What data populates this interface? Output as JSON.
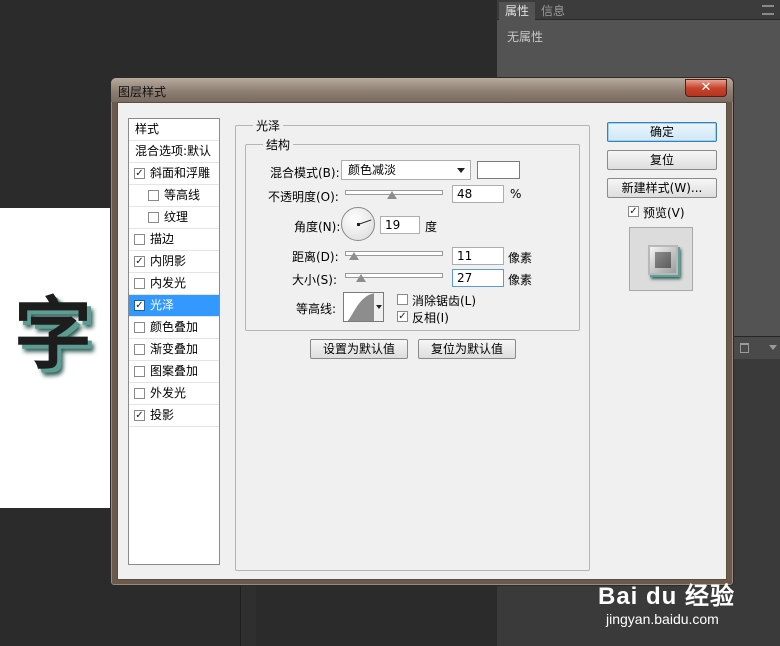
{
  "canvas": {
    "glyph": "字"
  },
  "properties_panel": {
    "tabs": [
      {
        "label": "属性",
        "active": true
      },
      {
        "label": "信息",
        "active": false
      }
    ],
    "body_text": "无属性"
  },
  "dialog": {
    "title": "图层样式",
    "close_label": "✕",
    "styles_list": {
      "header": "样式",
      "items": [
        {
          "label": "混合选项:默认",
          "checkbox": false,
          "checked": false,
          "indent": false,
          "selected": false
        },
        {
          "label": "斜面和浮雕",
          "checkbox": true,
          "checked": true,
          "indent": false,
          "selected": false
        },
        {
          "label": "等高线",
          "checkbox": true,
          "checked": false,
          "indent": true,
          "selected": false
        },
        {
          "label": "纹理",
          "checkbox": true,
          "checked": false,
          "indent": true,
          "selected": false
        },
        {
          "label": "描边",
          "checkbox": true,
          "checked": false,
          "indent": false,
          "selected": false
        },
        {
          "label": "内阴影",
          "checkbox": true,
          "checked": true,
          "indent": false,
          "selected": false
        },
        {
          "label": "内发光",
          "checkbox": true,
          "checked": false,
          "indent": false,
          "selected": false
        },
        {
          "label": "光泽",
          "checkbox": true,
          "checked": true,
          "indent": false,
          "selected": true
        },
        {
          "label": "颜色叠加",
          "checkbox": true,
          "checked": false,
          "indent": false,
          "selected": false
        },
        {
          "label": "渐变叠加",
          "checkbox": true,
          "checked": false,
          "indent": false,
          "selected": false
        },
        {
          "label": "图案叠加",
          "checkbox": true,
          "checked": false,
          "indent": false,
          "selected": false
        },
        {
          "label": "外发光",
          "checkbox": true,
          "checked": false,
          "indent": false,
          "selected": false
        },
        {
          "label": "投影",
          "checkbox": true,
          "checked": true,
          "indent": false,
          "selected": false
        }
      ]
    },
    "satin": {
      "group_title": "光泽",
      "structure_title": "结构",
      "blend_mode_label": "混合模式(B):",
      "blend_mode_value": "颜色减淡",
      "blend_color": "#ffffff",
      "opacity_label": "不透明度(O):",
      "opacity_value": "48",
      "opacity_unit": "%",
      "angle_label": "角度(N):",
      "angle_value": "19",
      "angle_unit": "度",
      "distance_label": "距离(D):",
      "distance_value": "11",
      "distance_unit": "像素",
      "size_label": "大小(S):",
      "size_value": "27",
      "size_unit": "像素",
      "contour_label": "等高线:",
      "anti_alias_label": "消除锯齿(L)",
      "anti_alias_checked": false,
      "invert_label": "反相(I)",
      "invert_checked": true,
      "make_default_button": "设置为默认值",
      "reset_default_button": "复位为默认值"
    },
    "side_buttons": {
      "ok": "确定",
      "reset": "复位",
      "new_style": "新建样式(W)...",
      "preview_label": "预览(V)",
      "preview_checked": true
    }
  },
  "watermark": {
    "brand": "Bai du 经验",
    "url": "jingyan.baidu.com"
  }
}
